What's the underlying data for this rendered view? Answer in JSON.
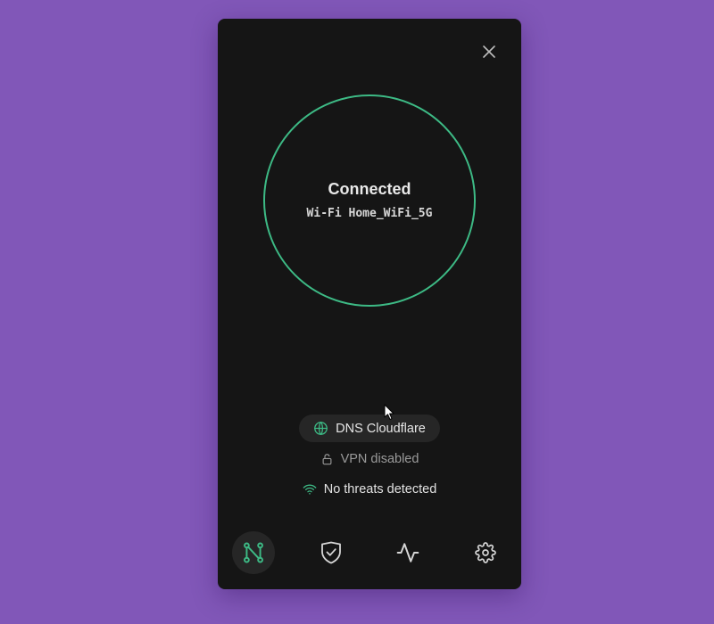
{
  "colors": {
    "background": "#8157b8",
    "panel": "#151515",
    "accent": "#3dba85",
    "pill": "#262626"
  },
  "status": {
    "title": "Connected",
    "network": "Wi-Fi Home_WiFi_5G"
  },
  "dns": {
    "label": "DNS Cloudflare",
    "icon": "globe-icon"
  },
  "vpn": {
    "label": "VPN disabled",
    "icon": "unlock-icon"
  },
  "threats": {
    "label": "No threats detected",
    "icon": "wifi-icon"
  },
  "nav": {
    "items": [
      {
        "icon": "network-nodes-icon",
        "active": true
      },
      {
        "icon": "shield-check-icon",
        "active": false
      },
      {
        "icon": "activity-icon",
        "active": false
      },
      {
        "icon": "gear-icon",
        "active": false
      }
    ]
  },
  "close": {
    "icon": "close-icon"
  }
}
